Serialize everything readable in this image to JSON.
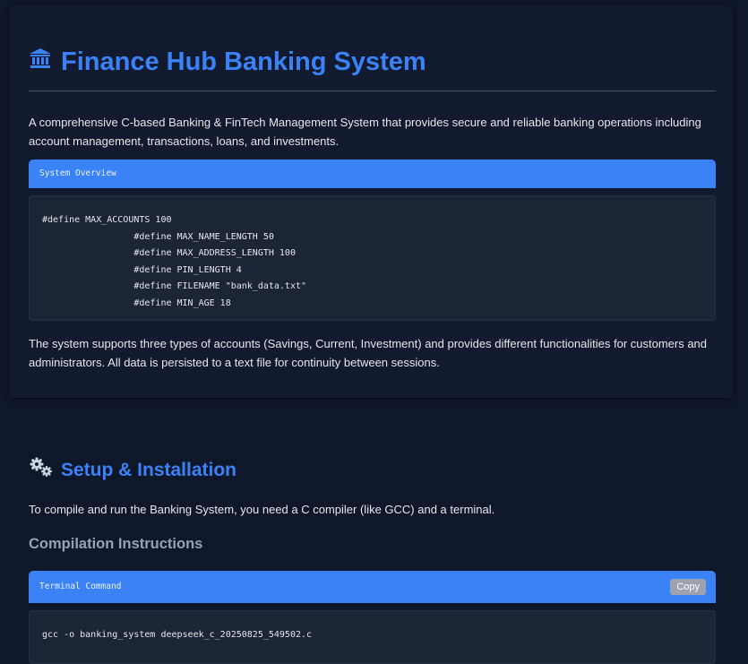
{
  "header": {
    "title": "Finance Hub Banking System",
    "icon": "bank-icon"
  },
  "intro": {
    "text": "A comprehensive C-based Banking & FinTech Management System that provides secure and reliable banking operations including account management, transactions, loans, and investments."
  },
  "overview": {
    "label": "System Overview",
    "code": "#define MAX_ACCOUNTS 100\n                 #define MAX_NAME_LENGTH 50\n                 #define MAX_ADDRESS_LENGTH 100\n                 #define PIN_LENGTH 4\n                 #define FILENAME \"bank_data.txt\"\n                 #define MIN_AGE 18"
  },
  "summary": {
    "text": "The system supports three types of accounts (Savings, Current, Investment) and provides different functionalities for customers and administrators. All data is persisted to a text file for continuity between sessions."
  },
  "setup": {
    "title": "Setup & Installation",
    "icon": "gears-icon",
    "text": "To compile and run the Banking System, you need a C compiler (like GCC) and a terminal.",
    "subtitle": "Compilation Instructions"
  },
  "terminal": {
    "label": "Terminal Command",
    "copy_label": "Copy",
    "code": "gcc -o banking_system deepseek_c_20250825_549502.c"
  },
  "colors": {
    "background": "#0f172a",
    "accent": "#3b82f6"
  }
}
